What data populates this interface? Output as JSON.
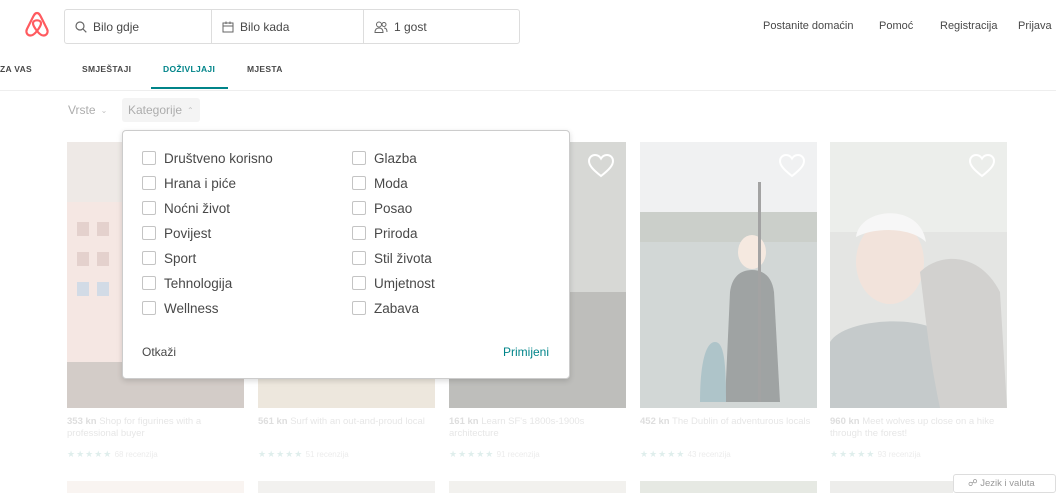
{
  "header": {
    "search": {
      "where": "Bilo gdje",
      "when": "Bilo kada",
      "guests": "1 gost"
    },
    "nav": [
      "Postanite domaćin",
      "Pomoć",
      "Registracija",
      "Prijava"
    ]
  },
  "tabs": [
    {
      "label": "ZA VAS",
      "active": false
    },
    {
      "label": "SMJEŠTAJI",
      "active": false
    },
    {
      "label": "DOŽIVLJAJI",
      "active": true
    },
    {
      "label": "MJESTA",
      "active": false
    }
  ],
  "filters": {
    "types": "Vrste",
    "categories": "Kategorije"
  },
  "dropdown": {
    "left_column": [
      "Društveno korisno",
      "Hrana i piće",
      "Noćni život",
      "Povijest",
      "Sport",
      "Tehnologija",
      "Wellness"
    ],
    "right_column": [
      "Glazba",
      "Moda",
      "Posao",
      "Priroda",
      "Stil života",
      "Umjetnost",
      "Zabava"
    ],
    "cancel": "Otkaži",
    "apply": "Primijeni"
  },
  "cards": [
    {
      "price": "353 kn",
      "title": "Shop for figurines with a professional buyer",
      "stars": "★★★★★",
      "reviews": "68 recenzija"
    },
    {
      "price": "561 kn",
      "title": "Surf with an out-and-proud local",
      "stars": "★★★★★",
      "reviews": "51 recenzija"
    },
    {
      "price": "161 kn",
      "title": "Learn SF's 1800s-1900s architecture",
      "stars": "★★★★★",
      "reviews": "91 recenzija"
    },
    {
      "price": "452 kn",
      "title": "The Dublin of adventurous locals",
      "stars": "★★★★★",
      "reviews": "43 recenzija"
    },
    {
      "price": "960 kn",
      "title": "Meet wolves up close on a hike through the forest!",
      "stars": "★★★★★",
      "reviews": "93 recenzija"
    }
  ],
  "footer": {
    "language": "Jezik i valuta"
  },
  "colors": {
    "brand": "#FF5A5F",
    "accent": "#008489"
  }
}
